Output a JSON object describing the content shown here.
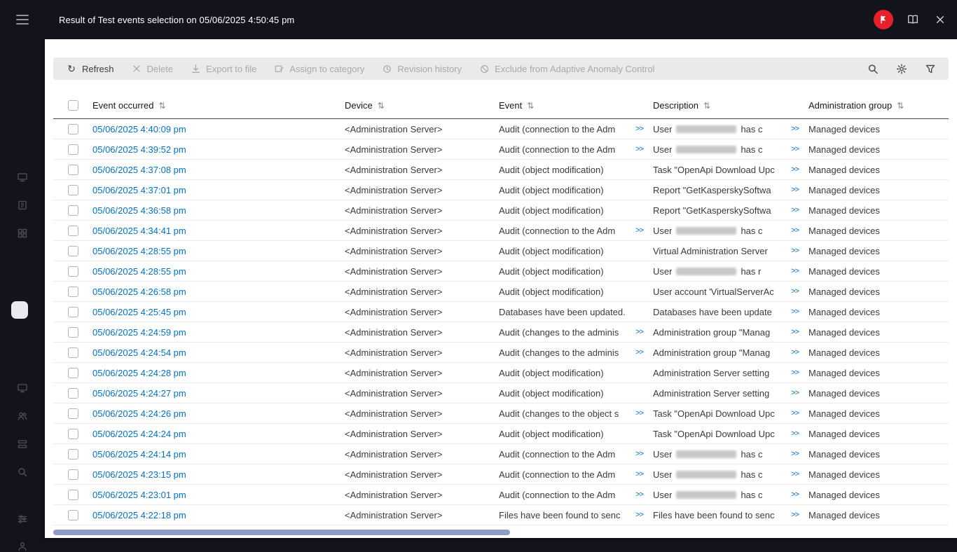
{
  "topbar": {
    "title": "Result of Test events selection on 05/06/2025 4:50:45 pm",
    "right_icons": [
      "notifications-badge",
      "documentation",
      "close"
    ]
  },
  "toolbar": {
    "buttons": [
      {
        "id": "refresh",
        "label": "Refresh",
        "enabled": true
      },
      {
        "id": "delete",
        "label": "Delete",
        "enabled": false
      },
      {
        "id": "export",
        "label": "Export to file",
        "enabled": false
      },
      {
        "id": "assign-category",
        "label": "Assign to category",
        "enabled": false
      },
      {
        "id": "revision-history",
        "label": "Revision history",
        "enabled": false
      },
      {
        "id": "exclude-aac",
        "label": "Exclude from Adaptive Anomaly Control",
        "enabled": false
      }
    ],
    "right_icons": [
      "search",
      "settings",
      "filter"
    ]
  },
  "table": {
    "sort_icon": "⇅",
    "expand_label": ">>",
    "columns": [
      {
        "id": "event-occurred",
        "label": "Event occurred"
      },
      {
        "id": "device",
        "label": "Device"
      },
      {
        "id": "event",
        "label": "Event"
      },
      {
        "id": "description",
        "label": "Description"
      },
      {
        "id": "administration-group",
        "label": "Administration group"
      }
    ],
    "rows": [
      {
        "time": "05/06/2025 4:40:09 pm",
        "device": "<Administration Server>",
        "event": "Audit (connection to the Adm",
        "event_more": true,
        "desc_pre": "User",
        "desc_blur": true,
        "desc_post": "has c",
        "desc_more": true,
        "group": "Managed devices"
      },
      {
        "time": "05/06/2025 4:39:52 pm",
        "device": "<Administration Server>",
        "event": "Audit (connection to the Adm",
        "event_more": true,
        "desc_pre": "User",
        "desc_blur": true,
        "desc_post": "has c",
        "desc_more": true,
        "group": "Managed devices"
      },
      {
        "time": "05/06/2025 4:37:08 pm",
        "device": "<Administration Server>",
        "event": "Audit (object modification)",
        "event_more": false,
        "desc_pre": "Task \"OpenApi Download Upc",
        "desc_blur": false,
        "desc_post": "",
        "desc_more": true,
        "group": "Managed devices"
      },
      {
        "time": "05/06/2025 4:37:01 pm",
        "device": "<Administration Server>",
        "event": "Audit (object modification)",
        "event_more": false,
        "desc_pre": "Report \"GetKasperskySoftwa",
        "desc_blur": false,
        "desc_post": "",
        "desc_more": true,
        "group": "Managed devices"
      },
      {
        "time": "05/06/2025 4:36:58 pm",
        "device": "<Administration Server>",
        "event": "Audit (object modification)",
        "event_more": false,
        "desc_pre": "Report \"GetKasperskySoftwa",
        "desc_blur": false,
        "desc_post": "",
        "desc_more": true,
        "group": "Managed devices"
      },
      {
        "time": "05/06/2025 4:34:41 pm",
        "device": "<Administration Server>",
        "event": "Audit (connection to the Adm",
        "event_more": true,
        "desc_pre": "User",
        "desc_blur": true,
        "desc_post": "has c",
        "desc_more": true,
        "group": "Managed devices"
      },
      {
        "time": "05/06/2025 4:28:55 pm",
        "device": "<Administration Server>",
        "event": "Audit (object modification)",
        "event_more": false,
        "desc_pre": "Virtual Administration Server",
        "desc_blur": false,
        "desc_post": "",
        "desc_more": true,
        "group": "Managed devices"
      },
      {
        "time": "05/06/2025 4:28:55 pm",
        "device": "<Administration Server>",
        "event": "Audit (object modification)",
        "event_more": false,
        "desc_pre": "User",
        "desc_blur": true,
        "desc_post": "has r",
        "desc_more": true,
        "group": "Managed devices"
      },
      {
        "time": "05/06/2025 4:26:58 pm",
        "device": "<Administration Server>",
        "event": "Audit (object modification)",
        "event_more": false,
        "desc_pre": "User account 'VirtualServerAc",
        "desc_blur": false,
        "desc_post": "",
        "desc_more": true,
        "group": "Managed devices"
      },
      {
        "time": "05/06/2025 4:25:45 pm",
        "device": "<Administration Server>",
        "event": "Databases have been updated.",
        "event_more": false,
        "desc_pre": "Databases have been update",
        "desc_blur": false,
        "desc_post": "",
        "desc_more": true,
        "group": "Managed devices"
      },
      {
        "time": "05/06/2025 4:24:59 pm",
        "device": "<Administration Server>",
        "event": "Audit (changes to the adminis",
        "event_more": true,
        "desc_pre": "Administration group \"Manag",
        "desc_blur": false,
        "desc_post": "",
        "desc_more": true,
        "group": "Managed devices"
      },
      {
        "time": "05/06/2025 4:24:54 pm",
        "device": "<Administration Server>",
        "event": "Audit (changes to the adminis",
        "event_more": true,
        "desc_pre": "Administration group \"Manag",
        "desc_blur": false,
        "desc_post": "",
        "desc_more": true,
        "group": "Managed devices"
      },
      {
        "time": "05/06/2025 4:24:28 pm",
        "device": "<Administration Server>",
        "event": "Audit (object modification)",
        "event_more": false,
        "desc_pre": "Administration Server setting",
        "desc_blur": false,
        "desc_post": "",
        "desc_more": true,
        "group": "Managed devices"
      },
      {
        "time": "05/06/2025 4:24:27 pm",
        "device": "<Administration Server>",
        "event": "Audit (object modification)",
        "event_more": false,
        "desc_pre": "Administration Server setting",
        "desc_blur": false,
        "desc_post": "",
        "desc_more": true,
        "group": "Managed devices"
      },
      {
        "time": "05/06/2025 4:24:26 pm",
        "device": "<Administration Server>",
        "event": "Audit (changes to the object s",
        "event_more": true,
        "desc_pre": "Task \"OpenApi Download Upc",
        "desc_blur": false,
        "desc_post": "",
        "desc_more": true,
        "group": "Managed devices"
      },
      {
        "time": "05/06/2025 4:24:24 pm",
        "device": "<Administration Server>",
        "event": "Audit (object modification)",
        "event_more": false,
        "desc_pre": "Task \"OpenApi Download Upc",
        "desc_blur": false,
        "desc_post": "",
        "desc_more": true,
        "group": "Managed devices"
      },
      {
        "time": "05/06/2025 4:24:14 pm",
        "device": "<Administration Server>",
        "event": "Audit (connection to the Adm",
        "event_more": true,
        "desc_pre": "User",
        "desc_blur": true,
        "desc_post": "has c",
        "desc_more": true,
        "group": "Managed devices"
      },
      {
        "time": "05/06/2025 4:23:15 pm",
        "device": "<Administration Server>",
        "event": "Audit (connection to the Adm",
        "event_more": true,
        "desc_pre": "User",
        "desc_blur": true,
        "desc_post": "has c",
        "desc_more": true,
        "group": "Managed devices"
      },
      {
        "time": "05/06/2025 4:23:01 pm",
        "device": "<Administration Server>",
        "event": "Audit (connection to the Adm",
        "event_more": true,
        "desc_pre": "User",
        "desc_blur": true,
        "desc_post": "has c",
        "desc_more": true,
        "group": "Managed devices"
      },
      {
        "time": "05/06/2025 4:22:18 pm",
        "device": "<Administration Server>",
        "event": "Files have been found to senc",
        "event_more": true,
        "desc_pre": "Files have been found to senc",
        "desc_blur": false,
        "desc_post": "",
        "desc_more": true,
        "group": "Managed devices"
      }
    ]
  }
}
